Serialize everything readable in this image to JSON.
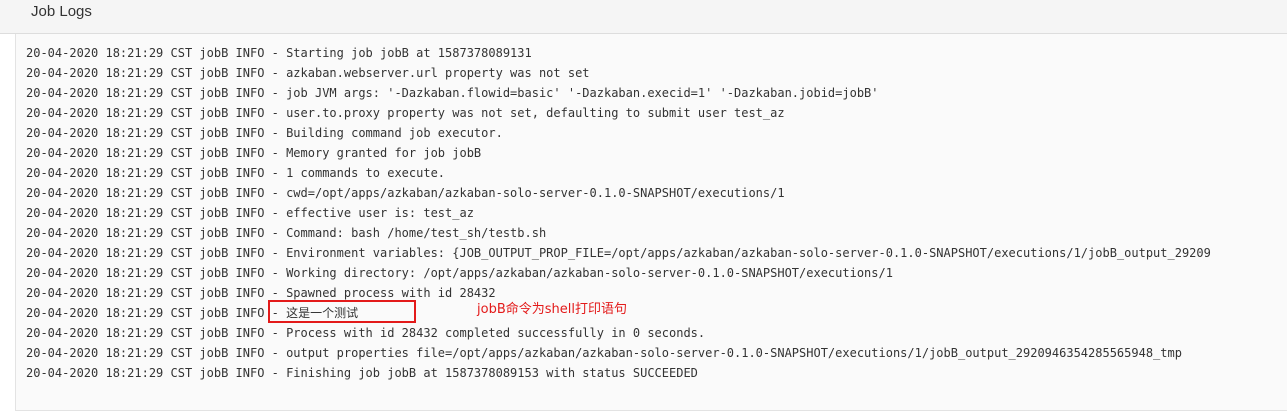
{
  "header": {
    "title": "Job Logs"
  },
  "log": {
    "lines": [
      "20-04-2020 18:21:29 CST jobB INFO - Starting job jobB at 1587378089131",
      "20-04-2020 18:21:29 CST jobB INFO - azkaban.webserver.url property was not set",
      "20-04-2020 18:21:29 CST jobB INFO - job JVM args: '-Dazkaban.flowid=basic' '-Dazkaban.execid=1' '-Dazkaban.jobid=jobB'",
      "20-04-2020 18:21:29 CST jobB INFO - user.to.proxy property was not set, defaulting to submit user test_az",
      "20-04-2020 18:21:29 CST jobB INFO - Building command job executor.",
      "20-04-2020 18:21:29 CST jobB INFO - Memory granted for job jobB",
      "20-04-2020 18:21:29 CST jobB INFO - 1 commands to execute.",
      "20-04-2020 18:21:29 CST jobB INFO - cwd=/opt/apps/azkaban/azkaban-solo-server-0.1.0-SNAPSHOT/executions/1",
      "20-04-2020 18:21:29 CST jobB INFO - effective user is: test_az",
      "20-04-2020 18:21:29 CST jobB INFO - Command: bash /home/test_sh/testb.sh",
      "20-04-2020 18:21:29 CST jobB INFO - Environment variables: {JOB_OUTPUT_PROP_FILE=/opt/apps/azkaban/azkaban-solo-server-0.1.0-SNAPSHOT/executions/1/jobB_output_29209",
      "20-04-2020 18:21:29 CST jobB INFO - Working directory: /opt/apps/azkaban/azkaban-solo-server-0.1.0-SNAPSHOT/executions/1",
      "20-04-2020 18:21:29 CST jobB INFO - Spawned process with id 28432",
      "20-04-2020 18:21:29 CST jobB INFO - 这是一个测试",
      "20-04-2020 18:21:29 CST jobB INFO - Process with id 28432 completed successfully in 0 seconds.",
      "20-04-2020 18:21:29 CST jobB INFO - output properties file=/opt/apps/azkaban/azkaban-solo-server-0.1.0-SNAPSHOT/executions/1/jobB_output_2920946354285565948_tmp",
      "20-04-2020 18:21:29 CST jobB INFO - Finishing job jobB at 1587378089153 with status SUCCEEDED"
    ]
  },
  "annotation": {
    "note": "jobB命令为shell打印语句",
    "color": "#e31a1a"
  }
}
